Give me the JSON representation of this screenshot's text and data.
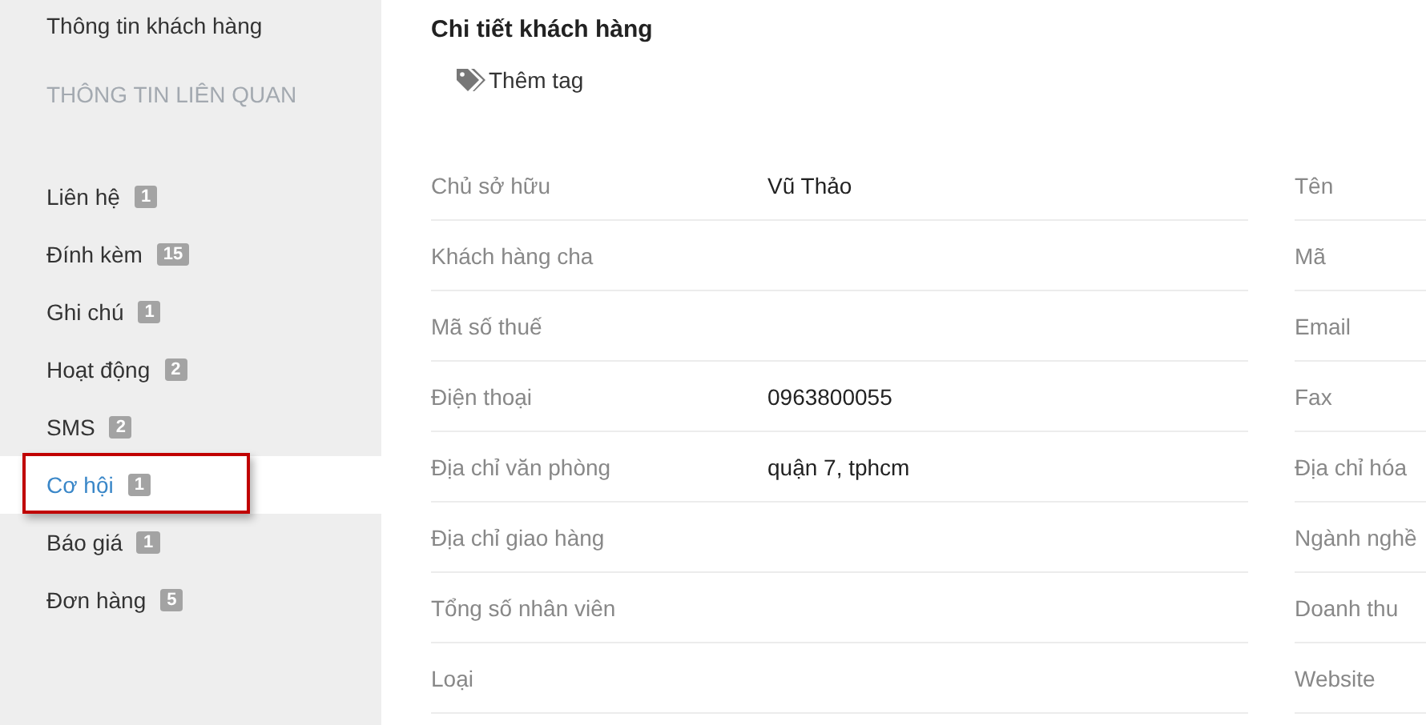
{
  "sidebar": {
    "top_item": "Thông tin khách hàng",
    "section_title": "THÔNG TIN LIÊN QUAN",
    "items": [
      {
        "label": "Liên hệ",
        "count": "1",
        "selected": false,
        "annotated": false
      },
      {
        "label": "Đính kèm",
        "count": "15",
        "selected": false,
        "annotated": false
      },
      {
        "label": "Ghi chú",
        "count": "1",
        "selected": false,
        "annotated": false
      },
      {
        "label": "Hoạt động",
        "count": "2",
        "selected": false,
        "annotated": false
      },
      {
        "label": "SMS",
        "count": "2",
        "selected": false,
        "annotated": false
      },
      {
        "label": "Cơ hội",
        "count": "1",
        "selected": true,
        "annotated": true
      },
      {
        "label": "Báo giá",
        "count": "1",
        "selected": false,
        "annotated": false
      },
      {
        "label": "Đơn hàng",
        "count": "5",
        "selected": false,
        "annotated": false
      }
    ]
  },
  "detail": {
    "title": "Chi tiết khách hàng",
    "add_tag": "Thêm tag",
    "left_fields": [
      {
        "label": "Chủ sở hữu",
        "value": "Vũ Thảo"
      },
      {
        "label": "Khách hàng cha"
      },
      {
        "label": "Mã số thuế"
      },
      {
        "label": "Điện thoại",
        "value": "0963800055"
      },
      {
        "label": "Địa chỉ văn phòng",
        "value": "quận 7, tphcm"
      },
      {
        "label": "Địa chỉ giao hàng"
      },
      {
        "label": "Tổng số nhân viên"
      },
      {
        "label": "Loại"
      }
    ],
    "right_fields": [
      {
        "label": "Tên"
      },
      {
        "label": "Mã"
      },
      {
        "label": "Email"
      },
      {
        "label": "Fax"
      },
      {
        "label": "Địa chỉ hóa"
      },
      {
        "label": "Ngành nghề"
      },
      {
        "label": "Doanh thu"
      },
      {
        "label": "Website"
      }
    ]
  }
}
